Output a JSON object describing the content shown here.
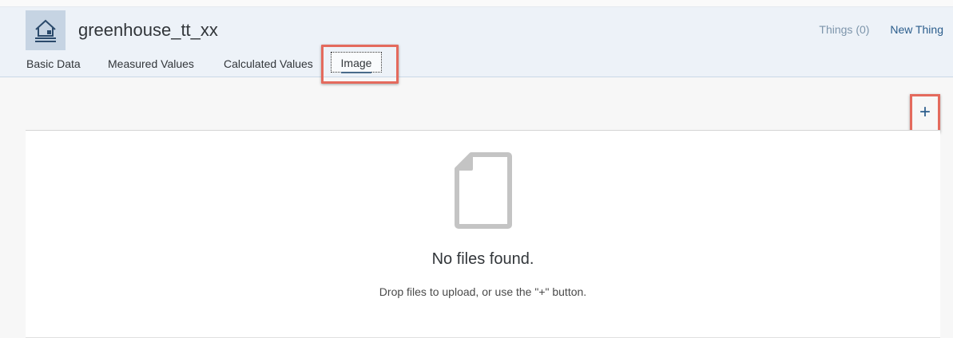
{
  "header": {
    "title": "greenhouse_tt_xx",
    "things_link": "Things (0)",
    "new_thing_link": "New Thing",
    "icon": "thing-house-icon"
  },
  "tabs": [
    {
      "label": "Basic Data",
      "selected": false
    },
    {
      "label": "Measured Values",
      "selected": false
    },
    {
      "label": "Calculated Values",
      "selected": false
    },
    {
      "label": "Image",
      "selected": true
    }
  ],
  "toolbar": {
    "add_label": "+",
    "add_icon": "plus-icon"
  },
  "empty_state": {
    "icon": "document-icon",
    "title": "No files found.",
    "hint": "Drop files to upload, or use the \"+\" button."
  },
  "colors": {
    "accent": "#2b5d8c",
    "highlight": "#e46a5d",
    "header_bg": "#edf2f8"
  }
}
